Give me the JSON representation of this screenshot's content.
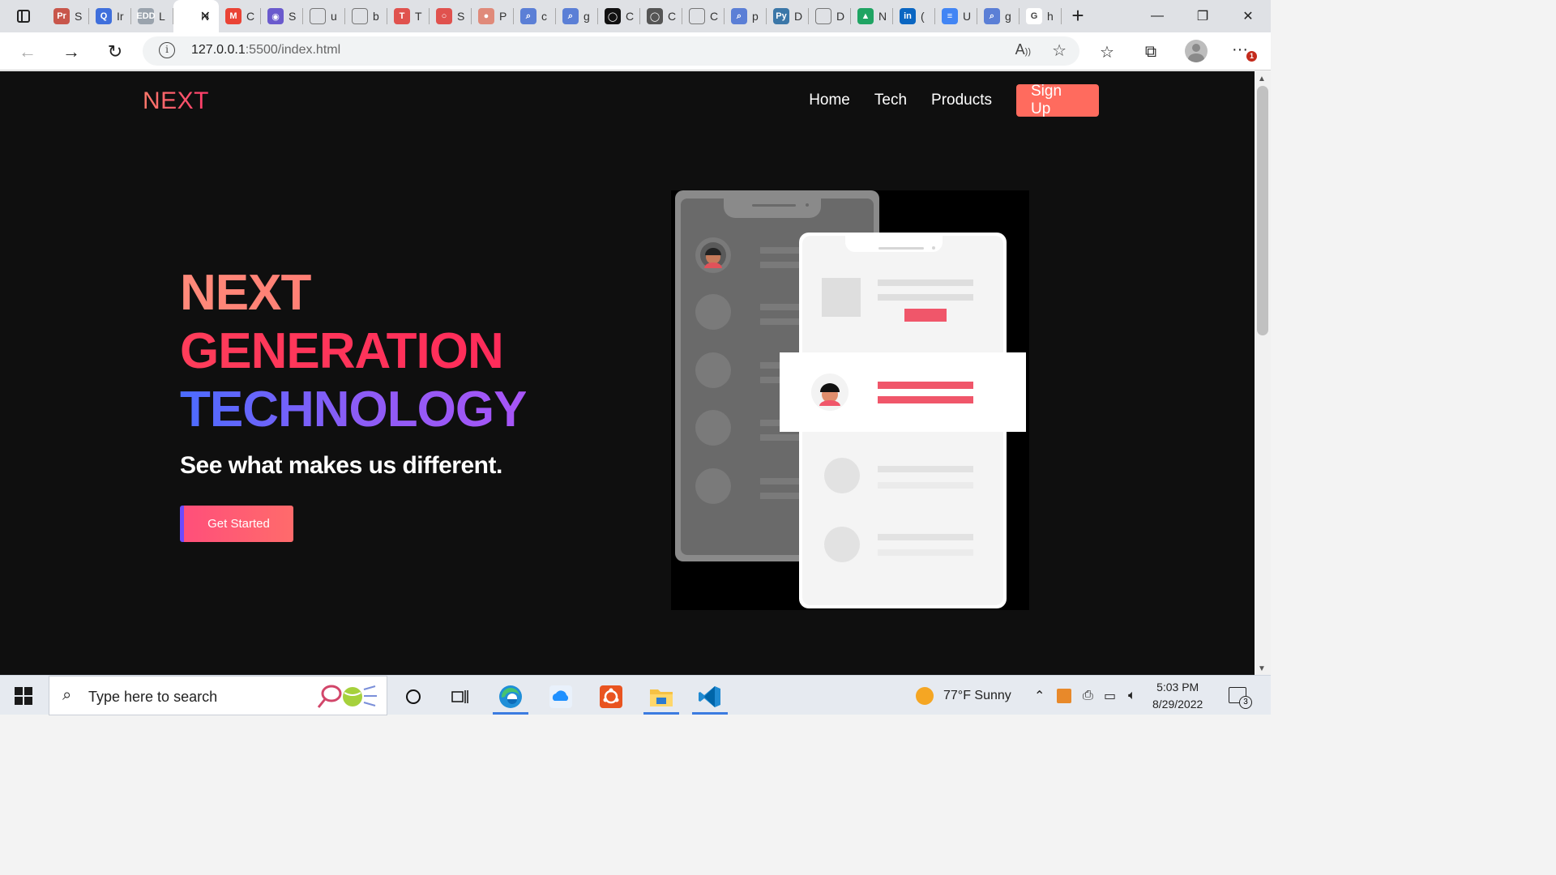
{
  "browser": {
    "tabs": [
      {
        "icon": "pr-icon",
        "label": "S",
        "fav_color": "#c8564b",
        "fav_text": "Pr"
      },
      {
        "icon": "quora-icon",
        "label": "Ir",
        "fav_color": "#3f6fdc",
        "fav_text": "Q"
      },
      {
        "icon": "edd-icon",
        "label": "L",
        "fav_color": "#9aa3ad",
        "fav_text": "EDD"
      },
      {
        "icon": "page-icon",
        "label": "N",
        "fav_color": "#ffffff",
        "fav_text": "",
        "active": true
      },
      {
        "icon": "gmail-icon",
        "label": "C",
        "fav_color": "#ea4335",
        "fav_text": "M"
      },
      {
        "icon": "record-icon",
        "label": "S",
        "fav_color": "#6a5acd",
        "fav_text": "◉"
      },
      {
        "icon": "doc-icon",
        "label": "u",
        "fav_color": "#dfe1e5",
        "fav_text": ""
      },
      {
        "icon": "blank-icon",
        "label": "b",
        "fav_color": "#dfe1e5",
        "fav_text": ""
      },
      {
        "icon": "tesla-icon",
        "label": "T",
        "fav_color": "#e0524e",
        "fav_text": "T"
      },
      {
        "icon": "oval-icon",
        "label": "S",
        "fav_color": "#e0524e",
        "fav_text": "○"
      },
      {
        "icon": "circle-icon",
        "label": "P",
        "fav_color": "#e08a7a",
        "fav_text": "●"
      },
      {
        "icon": "search-icon",
        "label": "c",
        "fav_color": "#5b7fd6",
        "fav_text": "⌕"
      },
      {
        "icon": "search-icon",
        "label": "g",
        "fav_color": "#5b7fd6",
        "fav_text": "⌕"
      },
      {
        "icon": "github-icon",
        "label": "C",
        "fav_color": "#111111",
        "fav_text": "◯"
      },
      {
        "icon": "github-icon",
        "label": "C",
        "fav_color": "#555555",
        "fav_text": "◯"
      },
      {
        "icon": "doc-icon",
        "label": "C",
        "fav_color": "#dfe1e5",
        "fav_text": ""
      },
      {
        "icon": "search-icon",
        "label": "p",
        "fav_color": "#5b7fd6",
        "fav_text": "⌕"
      },
      {
        "icon": "python-icon",
        "label": "D",
        "fav_color": "#3b77a8",
        "fav_text": "Py"
      },
      {
        "icon": "doc-icon",
        "label": "D",
        "fav_color": "#dfe1e5",
        "fav_text": ""
      },
      {
        "icon": "drive-icon",
        "label": "N",
        "fav_color": "#1fa463",
        "fav_text": "▲"
      },
      {
        "icon": "linkedin-icon",
        "label": "(",
        "fav_color": "#0a66c2",
        "fav_text": "in"
      },
      {
        "icon": "docs-icon",
        "label": "U",
        "fav_color": "#4285f4",
        "fav_text": "≡"
      },
      {
        "icon": "search-icon",
        "label": "g",
        "fav_color": "#5b7fd6",
        "fav_text": "⌕"
      },
      {
        "icon": "google-icon",
        "label": "h",
        "fav_color": "#ffffff",
        "fav_text": "G"
      }
    ],
    "url_host": "127.0.0.1",
    "url_path": ":5500/index.html"
  },
  "site": {
    "logo": "NEXT",
    "nav": [
      "Home",
      "Tech",
      "Products"
    ],
    "signup": "Sign Up",
    "hero": {
      "line1": "NEXT",
      "line2": "GENERATION",
      "line3": "TECHNOLOGY",
      "subtitle": "See what makes us different.",
      "cta": "Get Started"
    }
  },
  "taskbar": {
    "search_placeholder": "Type here to search",
    "weather": "77°F  Sunny",
    "time": "5:03 PM",
    "date": "8/29/2022",
    "notifications": "3"
  },
  "colors": {
    "accent": "#ff6b5e",
    "page_bg": "#0f0f0f",
    "gradient_blue": "#4b6cff",
    "gradient_purple": "#a855f7"
  }
}
